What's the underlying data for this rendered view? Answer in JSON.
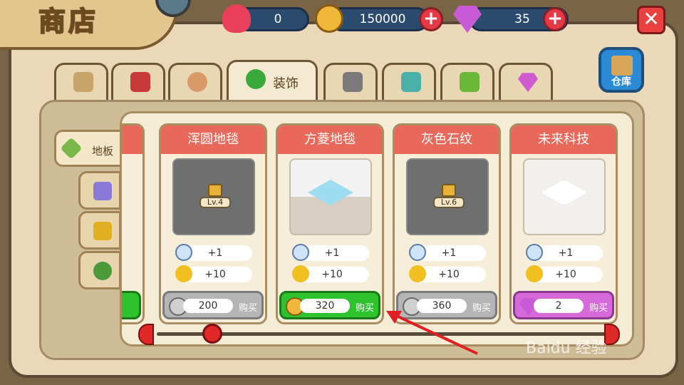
{
  "header": {
    "title": "商店",
    "hearts": "0",
    "coins": "150000",
    "gems": "35",
    "add_symbol": "+",
    "close_symbol": "✕"
  },
  "tabs": [
    {
      "icon": "box-icon"
    },
    {
      "icon": "book-icon"
    },
    {
      "icon": "food-icon"
    },
    {
      "icon": "clover-icon",
      "label": "装饰",
      "active": true
    },
    {
      "icon": "fridge-icon"
    },
    {
      "icon": "window-icon"
    },
    {
      "icon": "plants-icon"
    },
    {
      "icon": "gem-icon"
    }
  ],
  "warehouse": {
    "label": "仓库"
  },
  "side_tabs": [
    {
      "label": "地板",
      "active": true
    },
    {
      "icon": "wallpaper-icon"
    },
    {
      "icon": "lamp-icon"
    },
    {
      "icon": "potted-plant-icon"
    }
  ],
  "cards": [
    {
      "name": "浑圆地毯",
      "locked": true,
      "level": "Lv.4",
      "stat1": "+1",
      "stat2": "+10",
      "price": "200",
      "buy": "购买",
      "currency": "silver-coin",
      "button": "gray"
    },
    {
      "name": "方菱地毯",
      "locked": false,
      "stat1": "+1",
      "stat2": "+10",
      "price": "320",
      "buy": "购买",
      "currency": "gold-coin",
      "button": "green"
    },
    {
      "name": "灰色石纹",
      "locked": true,
      "level": "Lv.6",
      "stat1": "+1",
      "stat2": "+10",
      "price": "360",
      "buy": "购买",
      "currency": "silver-coin",
      "button": "gray"
    },
    {
      "name": "未来科技",
      "locked": false,
      "stat1": "+1",
      "stat2": "+10",
      "price": "2",
      "buy": "购买",
      "currency": "gem",
      "button": "pink"
    }
  ],
  "watermark": "Baidu 经验"
}
